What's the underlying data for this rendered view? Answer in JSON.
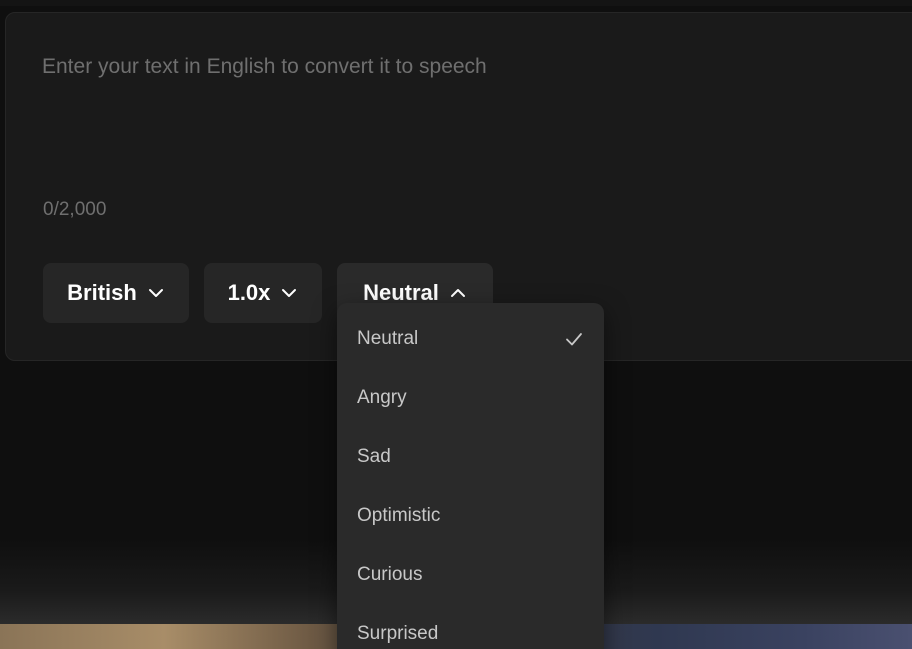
{
  "editor": {
    "placeholder": "Enter your text in English to convert it to speech",
    "value": "",
    "char_count": "0/2,000"
  },
  "controls": {
    "accent": {
      "label": "British",
      "icon": "chevron-down-icon"
    },
    "speed": {
      "label": "1.0x",
      "icon": "chevron-down-icon"
    },
    "emotion": {
      "label": "Neutral",
      "icon": "chevron-up-icon",
      "expanded": true
    }
  },
  "emotion_menu": {
    "selected": "Neutral",
    "selected_icon": "check-icon",
    "options": [
      {
        "label": "Neutral",
        "selected": true
      },
      {
        "label": "Angry",
        "selected": false
      },
      {
        "label": "Sad",
        "selected": false
      },
      {
        "label": "Optimistic",
        "selected": false
      },
      {
        "label": "Curious",
        "selected": false
      },
      {
        "label": "Surprised",
        "selected": false
      }
    ]
  },
  "colors": {
    "background": "#0f0f0f",
    "card": "#1a1a1a",
    "pill": "#262626",
    "menu": "#2a2a2a",
    "text_primary": "#ffffff",
    "text_muted": "#6f6f6f"
  }
}
